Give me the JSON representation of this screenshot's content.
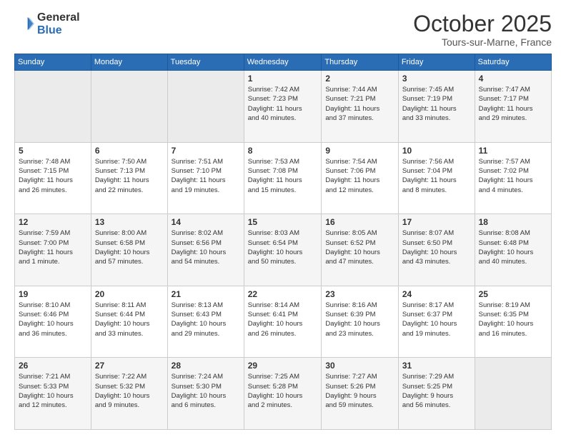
{
  "logo": {
    "general": "General",
    "blue": "Blue"
  },
  "header": {
    "month": "October 2025",
    "location": "Tours-sur-Marne, France"
  },
  "weekdays": [
    "Sunday",
    "Monday",
    "Tuesday",
    "Wednesday",
    "Thursday",
    "Friday",
    "Saturday"
  ],
  "weeks": [
    [
      {
        "day": "",
        "info": ""
      },
      {
        "day": "",
        "info": ""
      },
      {
        "day": "",
        "info": ""
      },
      {
        "day": "1",
        "info": "Sunrise: 7:42 AM\nSunset: 7:23 PM\nDaylight: 11 hours\nand 40 minutes."
      },
      {
        "day": "2",
        "info": "Sunrise: 7:44 AM\nSunset: 7:21 PM\nDaylight: 11 hours\nand 37 minutes."
      },
      {
        "day": "3",
        "info": "Sunrise: 7:45 AM\nSunset: 7:19 PM\nDaylight: 11 hours\nand 33 minutes."
      },
      {
        "day": "4",
        "info": "Sunrise: 7:47 AM\nSunset: 7:17 PM\nDaylight: 11 hours\nand 29 minutes."
      }
    ],
    [
      {
        "day": "5",
        "info": "Sunrise: 7:48 AM\nSunset: 7:15 PM\nDaylight: 11 hours\nand 26 minutes."
      },
      {
        "day": "6",
        "info": "Sunrise: 7:50 AM\nSunset: 7:13 PM\nDaylight: 11 hours\nand 22 minutes."
      },
      {
        "day": "7",
        "info": "Sunrise: 7:51 AM\nSunset: 7:10 PM\nDaylight: 11 hours\nand 19 minutes."
      },
      {
        "day": "8",
        "info": "Sunrise: 7:53 AM\nSunset: 7:08 PM\nDaylight: 11 hours\nand 15 minutes."
      },
      {
        "day": "9",
        "info": "Sunrise: 7:54 AM\nSunset: 7:06 PM\nDaylight: 11 hours\nand 12 minutes."
      },
      {
        "day": "10",
        "info": "Sunrise: 7:56 AM\nSunset: 7:04 PM\nDaylight: 11 hours\nand 8 minutes."
      },
      {
        "day": "11",
        "info": "Sunrise: 7:57 AM\nSunset: 7:02 PM\nDaylight: 11 hours\nand 4 minutes."
      }
    ],
    [
      {
        "day": "12",
        "info": "Sunrise: 7:59 AM\nSunset: 7:00 PM\nDaylight: 11 hours\nand 1 minute."
      },
      {
        "day": "13",
        "info": "Sunrise: 8:00 AM\nSunset: 6:58 PM\nDaylight: 10 hours\nand 57 minutes."
      },
      {
        "day": "14",
        "info": "Sunrise: 8:02 AM\nSunset: 6:56 PM\nDaylight: 10 hours\nand 54 minutes."
      },
      {
        "day": "15",
        "info": "Sunrise: 8:03 AM\nSunset: 6:54 PM\nDaylight: 10 hours\nand 50 minutes."
      },
      {
        "day": "16",
        "info": "Sunrise: 8:05 AM\nSunset: 6:52 PM\nDaylight: 10 hours\nand 47 minutes."
      },
      {
        "day": "17",
        "info": "Sunrise: 8:07 AM\nSunset: 6:50 PM\nDaylight: 10 hours\nand 43 minutes."
      },
      {
        "day": "18",
        "info": "Sunrise: 8:08 AM\nSunset: 6:48 PM\nDaylight: 10 hours\nand 40 minutes."
      }
    ],
    [
      {
        "day": "19",
        "info": "Sunrise: 8:10 AM\nSunset: 6:46 PM\nDaylight: 10 hours\nand 36 minutes."
      },
      {
        "day": "20",
        "info": "Sunrise: 8:11 AM\nSunset: 6:44 PM\nDaylight: 10 hours\nand 33 minutes."
      },
      {
        "day": "21",
        "info": "Sunrise: 8:13 AM\nSunset: 6:43 PM\nDaylight: 10 hours\nand 29 minutes."
      },
      {
        "day": "22",
        "info": "Sunrise: 8:14 AM\nSunset: 6:41 PM\nDaylight: 10 hours\nand 26 minutes."
      },
      {
        "day": "23",
        "info": "Sunrise: 8:16 AM\nSunset: 6:39 PM\nDaylight: 10 hours\nand 23 minutes."
      },
      {
        "day": "24",
        "info": "Sunrise: 8:17 AM\nSunset: 6:37 PM\nDaylight: 10 hours\nand 19 minutes."
      },
      {
        "day": "25",
        "info": "Sunrise: 8:19 AM\nSunset: 6:35 PM\nDaylight: 10 hours\nand 16 minutes."
      }
    ],
    [
      {
        "day": "26",
        "info": "Sunrise: 7:21 AM\nSunset: 5:33 PM\nDaylight: 10 hours\nand 12 minutes."
      },
      {
        "day": "27",
        "info": "Sunrise: 7:22 AM\nSunset: 5:32 PM\nDaylight: 10 hours\nand 9 minutes."
      },
      {
        "day": "28",
        "info": "Sunrise: 7:24 AM\nSunset: 5:30 PM\nDaylight: 10 hours\nand 6 minutes."
      },
      {
        "day": "29",
        "info": "Sunrise: 7:25 AM\nSunset: 5:28 PM\nDaylight: 10 hours\nand 2 minutes."
      },
      {
        "day": "30",
        "info": "Sunrise: 7:27 AM\nSunset: 5:26 PM\nDaylight: 9 hours\nand 59 minutes."
      },
      {
        "day": "31",
        "info": "Sunrise: 7:29 AM\nSunset: 5:25 PM\nDaylight: 9 hours\nand 56 minutes."
      },
      {
        "day": "",
        "info": ""
      }
    ]
  ]
}
